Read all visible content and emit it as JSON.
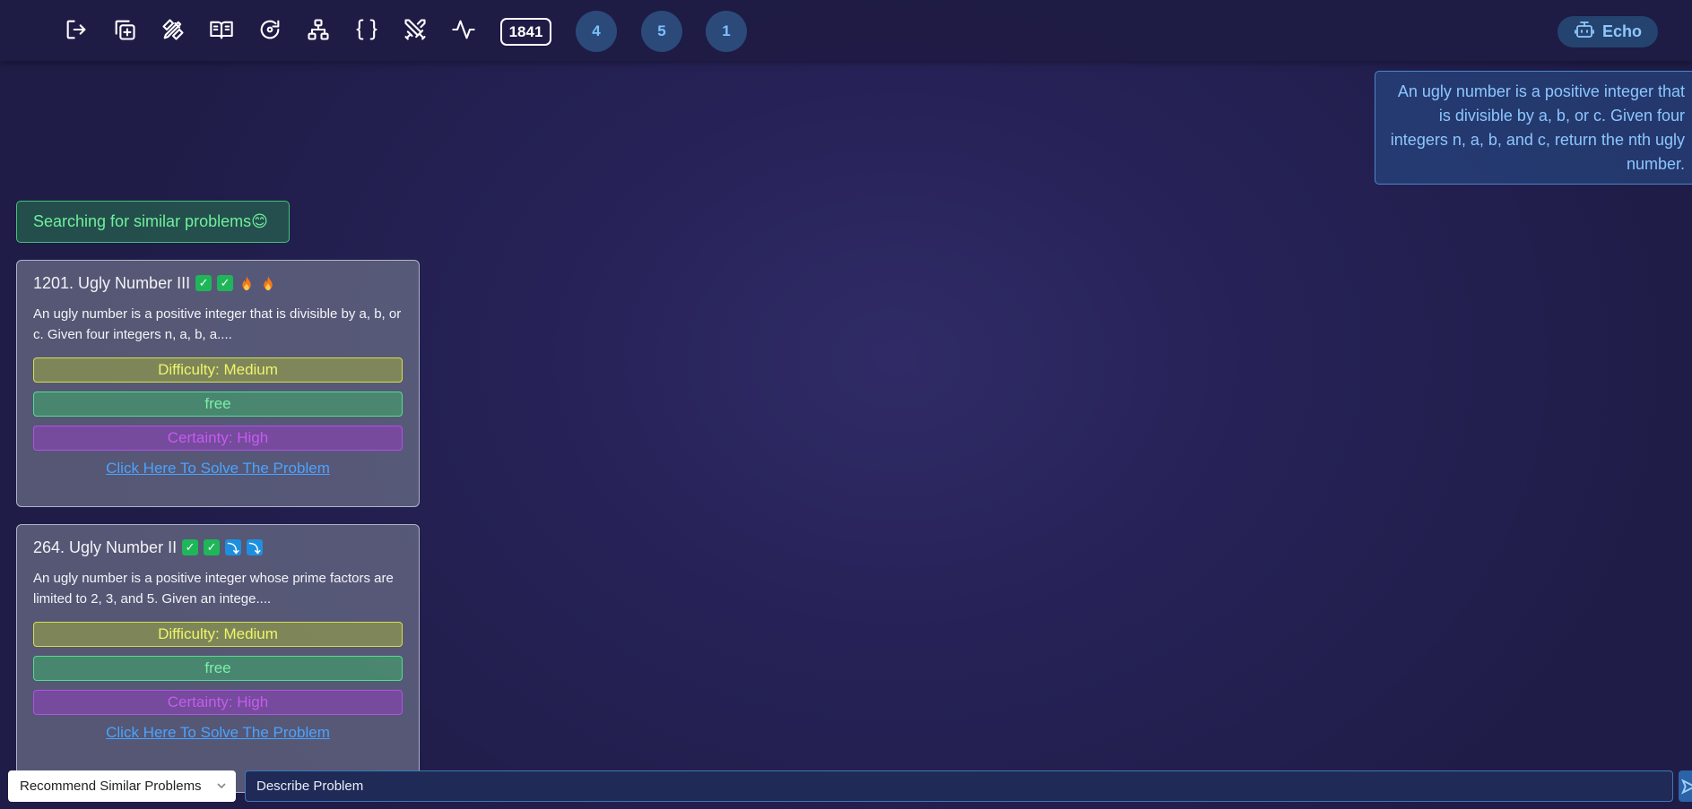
{
  "toolbar": {
    "icons": [
      "logout-icon",
      "copy-plus-icon",
      "pencil-ruler-icon",
      "book-open-icon",
      "refresh-icon",
      "network-icon",
      "braces-icon",
      "swords-icon",
      "activity-icon"
    ],
    "count": "1841",
    "circles": [
      "4",
      "5",
      "1"
    ],
    "echo_label": "Echo"
  },
  "chat": {
    "user_message": "An ugly number is a positive integer that is divisible by a, b, or c. Given four integers n, a, b, and c, return the nth ugly number.",
    "status": "Searching for similar problems😊"
  },
  "problems": [
    {
      "title": "1201. Ugly Number III",
      "badges": [
        "check",
        "check",
        "fire",
        "fire"
      ],
      "description": "An ugly number is a positive integer that is divisible by a, b, or c. Given four integers n, a, b, a....",
      "difficulty": "Difficulty: Medium",
      "access": "free",
      "certainty": "Certainty: High",
      "link": "Click Here To Solve The Problem"
    },
    {
      "title": "264. Ugly Number II",
      "badges": [
        "check",
        "check",
        "arrow-down",
        "arrow-down"
      ],
      "description": "An ugly number is a positive integer whose prime factors are limited to 2, 3, and 5. Given an intege....",
      "difficulty": "Difficulty: Medium",
      "access": "free",
      "certainty": "Certainty: High",
      "link": "Click Here To Solve The Problem"
    }
  ],
  "input_bar": {
    "mode": "Recommend Similar Problems",
    "input_value": "Describe Problem"
  },
  "colors": {
    "background": "#262257",
    "accent_blue": "#4aa3ff",
    "status_green": "#6ff09c",
    "difficulty_yellow": "#eef56a",
    "certainty_purple": "#c45cf0"
  }
}
